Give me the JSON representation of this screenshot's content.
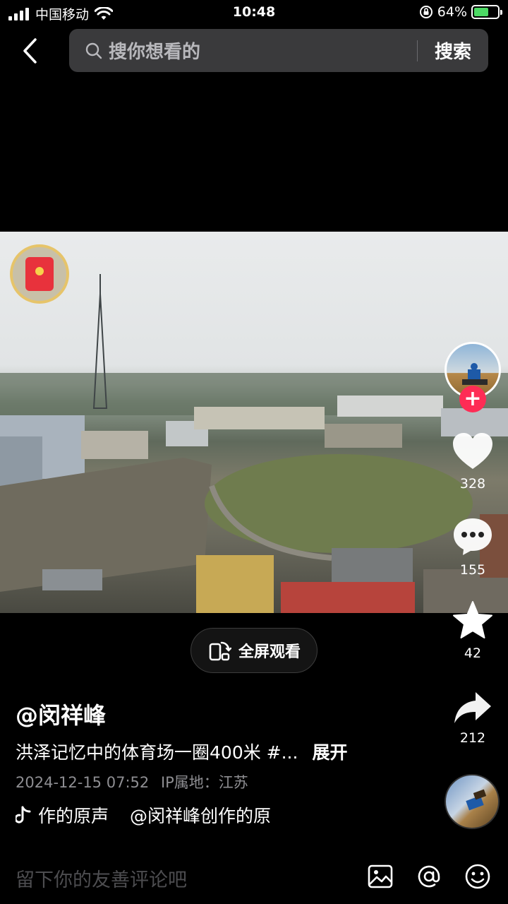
{
  "status_bar": {
    "carrier": "中国移动",
    "time": "10:48",
    "battery_percent": "64%",
    "battery_level": 0.64,
    "icons": [
      "signal-icon",
      "wifi-icon",
      "orientation-lock-icon",
      "battery-icon"
    ]
  },
  "header": {
    "search_placeholder": "搜你想看的",
    "search_button": "搜索"
  },
  "video": {
    "fullscreen_label": "全屏观看"
  },
  "actions": {
    "like_count": "328",
    "comment_count": "155",
    "favorite_count": "42",
    "share_count": "212"
  },
  "post": {
    "author": "@闵祥峰",
    "description": "洪泽记忆中的体育场一圈400米 #...",
    "expand_label": "展开",
    "date": "2024-12-15 07:52",
    "ip_location": "IP属地：江苏",
    "music_title": "作的原声",
    "music_source": "@闵祥峰创作的原"
  },
  "comment_bar": {
    "placeholder": "留下你的友善评论吧"
  },
  "colors": {
    "accent": "#fe2c55",
    "background": "#000000",
    "search_bg": "#3a3a3c"
  }
}
